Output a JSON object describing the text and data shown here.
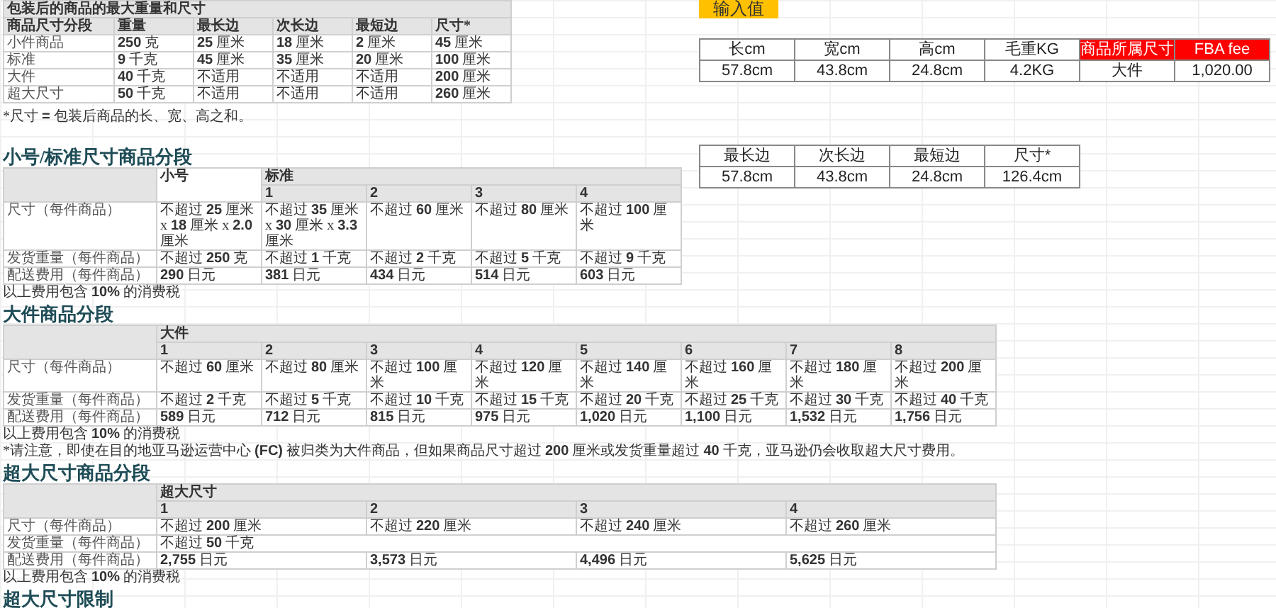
{
  "size_limits": {
    "title": "包装后的商品的最大重量和尺寸",
    "columns": [
      "商品尺寸分段",
      "重量",
      "最长边",
      "次长边",
      "最短边",
      "尺寸*"
    ],
    "rows": [
      [
        "小件商品",
        "**250** 克",
        "**25** 厘米",
        "**18** 厘米",
        "**2** 厘米",
        "**45** 厘米"
      ],
      [
        "标准",
        "**9** 千克",
        "**45** 厘米",
        "**35** 厘米",
        "**20** 厘米",
        "**100** 厘米"
      ],
      [
        "大件",
        "**40** 千克",
        "不适用",
        "不适用",
        "不适用",
        "**200** 厘米"
      ],
      [
        "超大尺寸",
        "**50** 千克",
        "不适用",
        "不适用",
        "不适用",
        "**260** 厘米"
      ]
    ],
    "note": "*尺寸 **=** 包装后商品的长、宽、高之和。"
  },
  "tiers": [
    {
      "heading": "小号/标准尺寸商品分段",
      "groups": [
        {
          "label": "小号"
        },
        {
          "label": "标准",
          "numbers": [
            "1",
            "2",
            "3",
            "4"
          ]
        }
      ],
      "rows": [
        {
          "label": "尺寸（每件商品）",
          "cells": [
            "不超过 **25** 厘米 x **18** 厘米 x **2.0** 厘米",
            "不超过 **35** 厘米 x **30** 厘米 x **3.3** 厘米",
            "不超过 **60** 厘米",
            "不超过 **80** 厘米",
            "不超过 **100** 厘米"
          ]
        },
        {
          "label": "发货重量（每件商品）",
          "cells": [
            "不超过 **250** 克",
            "不超过 **1** 千克",
            "不超过 **2** 千克",
            "不超过 **5** 千克",
            "不超过 **9** 千克"
          ]
        },
        {
          "label": "配送费用（每件商品）",
          "cells": [
            "**290** 日元",
            "**381** 日元",
            "**434** 日元",
            "**514** 日元",
            "**603** 日元"
          ]
        }
      ],
      "notes": [
        "以上费用包含 **10%** 的消费税"
      ]
    },
    {
      "heading": "大件商品分段",
      "groups": [
        {
          "label": "大件",
          "numbers": [
            "1",
            "2",
            "3",
            "4",
            "5",
            "6",
            "7",
            "8"
          ]
        }
      ],
      "rows": [
        {
          "label": "尺寸（每件商品）",
          "cells": [
            "不超过 **60** 厘米",
            "不超过 **80** 厘米",
            "不超过 **100** 厘米",
            "不超过 **120** 厘米",
            "不超过 **140** 厘米",
            "不超过 **160** 厘米",
            "不超过 **180** 厘米",
            "不超过 **200** 厘米"
          ]
        },
        {
          "label": "发货重量（每件商品）",
          "cells": [
            "不超过 **2** 千克",
            "不超过 **5** 千克",
            "不超过 **10** 千克",
            "不超过 **15** 千克",
            "不超过 **20** 千克",
            "不超过 **25** 千克",
            "不超过 **30** 千克",
            "不超过 **40** 千克"
          ]
        },
        {
          "label": "配送费用（每件商品）",
          "cells": [
            "**589** 日元",
            "**712** 日元",
            "**815** 日元",
            "**975** 日元",
            "**1,020** 日元",
            "**1,100** 日元",
            "**1,532** 日元",
            "**1,756** 日元"
          ]
        }
      ],
      "notes": [
        "以上费用包含 **10%** 的消费税",
        "*请注意，即使在目的地亚马逊运营中心 **(FC)** 被归类为大件商品，但如果商品尺寸超过 **200** 厘米或发货重量超过 **40** 千克，亚马逊仍会收取超大尺寸费用。"
      ]
    },
    {
      "heading": "超大尺寸商品分段",
      "groups": [
        {
          "label": "超大尺寸",
          "numbers": [
            "1",
            "2",
            "3",
            "4"
          ]
        }
      ],
      "rows": [
        {
          "label": "尺寸（每件商品）",
          "cells": [
            "不超过 **200** 厘米",
            "不超过 **220** 厘米",
            "不超过 **240** 厘米",
            "不超过 **260** 厘米"
          ]
        },
        {
          "label": "发货重量（每件商品）",
          "cells": [
            {
              "text": "不超过 **50** 千克",
              "colspan": 4
            }
          ]
        },
        {
          "label": "配送费用（每件商品）",
          "cells": [
            "**2,755** 日元",
            "**3,573** 日元",
            "**4,496** 日元",
            "**5,625** 日元"
          ]
        }
      ],
      "notes": [
        "以上费用包含 **10%** 的消费税"
      ]
    }
  ],
  "last_heading": "超大尺寸限制",
  "calculator": {
    "input_label": "输入值",
    "inputs": {
      "columns": [
        {
          "label": "长cm",
          "highlight": false
        },
        {
          "label": "宽cm",
          "highlight": false
        },
        {
          "label": "高cm",
          "highlight": false
        },
        {
          "label": "毛重KG",
          "highlight": false
        },
        {
          "label": "商品所属尺寸",
          "highlight": true
        },
        {
          "label": "FBA fee",
          "highlight": true
        }
      ],
      "values": [
        "57.8cm",
        "43.8cm",
        "24.8cm",
        "4.2KG",
        "大件",
        "1,020.00"
      ]
    },
    "derived": {
      "columns": [
        {
          "label": "最长边",
          "highlight": false
        },
        {
          "label": "次长边",
          "highlight": false
        },
        {
          "label": "最短边",
          "highlight": false
        },
        {
          "label": "尺寸*",
          "highlight": false
        }
      ],
      "values": [
        "57.8cm",
        "43.8cm",
        "24.8cm",
        "126.4cm"
      ]
    }
  }
}
